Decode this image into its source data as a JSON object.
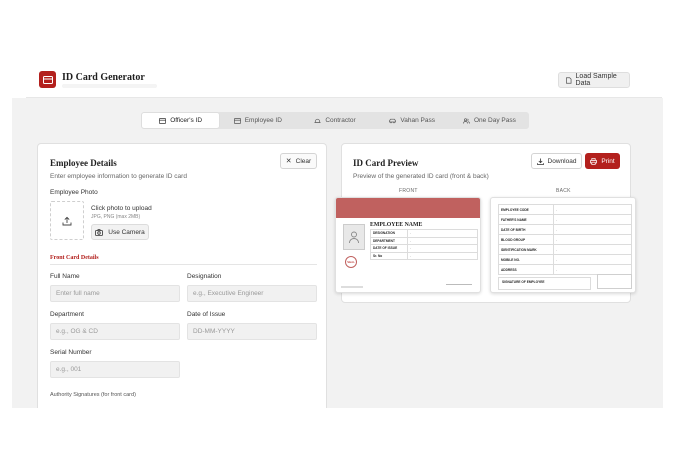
{
  "header": {
    "title": "ID Card Generator",
    "sample_button": "Load Sample Data"
  },
  "tabs": [
    {
      "label": "Officer's ID",
      "active": true
    },
    {
      "label": "Employee ID",
      "active": false
    },
    {
      "label": "Contractor",
      "active": false
    },
    {
      "label": "Vahan Pass",
      "active": false
    },
    {
      "label": "One Day Pass",
      "active": false
    }
  ],
  "employee_details": {
    "title": "Employee Details",
    "subtitle": "Enter employee information to generate ID card",
    "clear_button": "Clear",
    "photo_label": "Employee Photo",
    "photo_upload_text": "Click photo to upload",
    "photo_formats": "JPG, PNG (max 2MB)",
    "camera_button": "Use Camera",
    "front_section": "Front Card Details",
    "fields": {
      "full_name": {
        "label": "Full Name",
        "placeholder": "Enter full name"
      },
      "designation": {
        "label": "Designation",
        "placeholder": "e.g., Executive Engineer"
      },
      "department": {
        "label": "Department",
        "placeholder": "e.g., OG & CD"
      },
      "date_of_issue": {
        "label": "Date of Issue",
        "placeholder": "DD-MM-YYYY"
      },
      "serial_number": {
        "label": "Serial Number",
        "placeholder": "e.g., 001"
      }
    },
    "signatures_label": "Authority Signatures (for front card)"
  },
  "preview": {
    "title": "ID Card Preview",
    "subtitle": "Preview of the generated ID card (front & back)",
    "download_button": "Download",
    "print_button": "Print",
    "front_label": "FRONT",
    "back_label": "BACK",
    "front_card": {
      "name": "EMPLOYEE NAME",
      "rows": [
        {
          "k": "DESIGNATION",
          "v": "-"
        },
        {
          "k": "DEPARTMENT",
          "v": "-"
        },
        {
          "k": "DATE OF ISSUE",
          "v": "-"
        },
        {
          "k": "Sr. No",
          "v": "-"
        }
      ],
      "seal": "SEAL"
    },
    "back_card": {
      "rows": [
        {
          "k": "EMPLOYEE CODE",
          "v": "-"
        },
        {
          "k": "FATHER'S NAME",
          "v": "-"
        },
        {
          "k": "DATE OF BIRTH",
          "v": "-"
        },
        {
          "k": "BLOOD GROUP",
          "v": "-"
        },
        {
          "k": "IDENTIFICATION MARK",
          "v": "-"
        },
        {
          "k": "MOBILE NO.",
          "v": "-"
        },
        {
          "k": "ADDRESS",
          "v": "-"
        }
      ],
      "signature_label": "SIGNATURE OF EMPLOYEE"
    }
  },
  "colors": {
    "brand": "#b3201d",
    "band": "#c0615f",
    "background": "#f2f2f2"
  }
}
